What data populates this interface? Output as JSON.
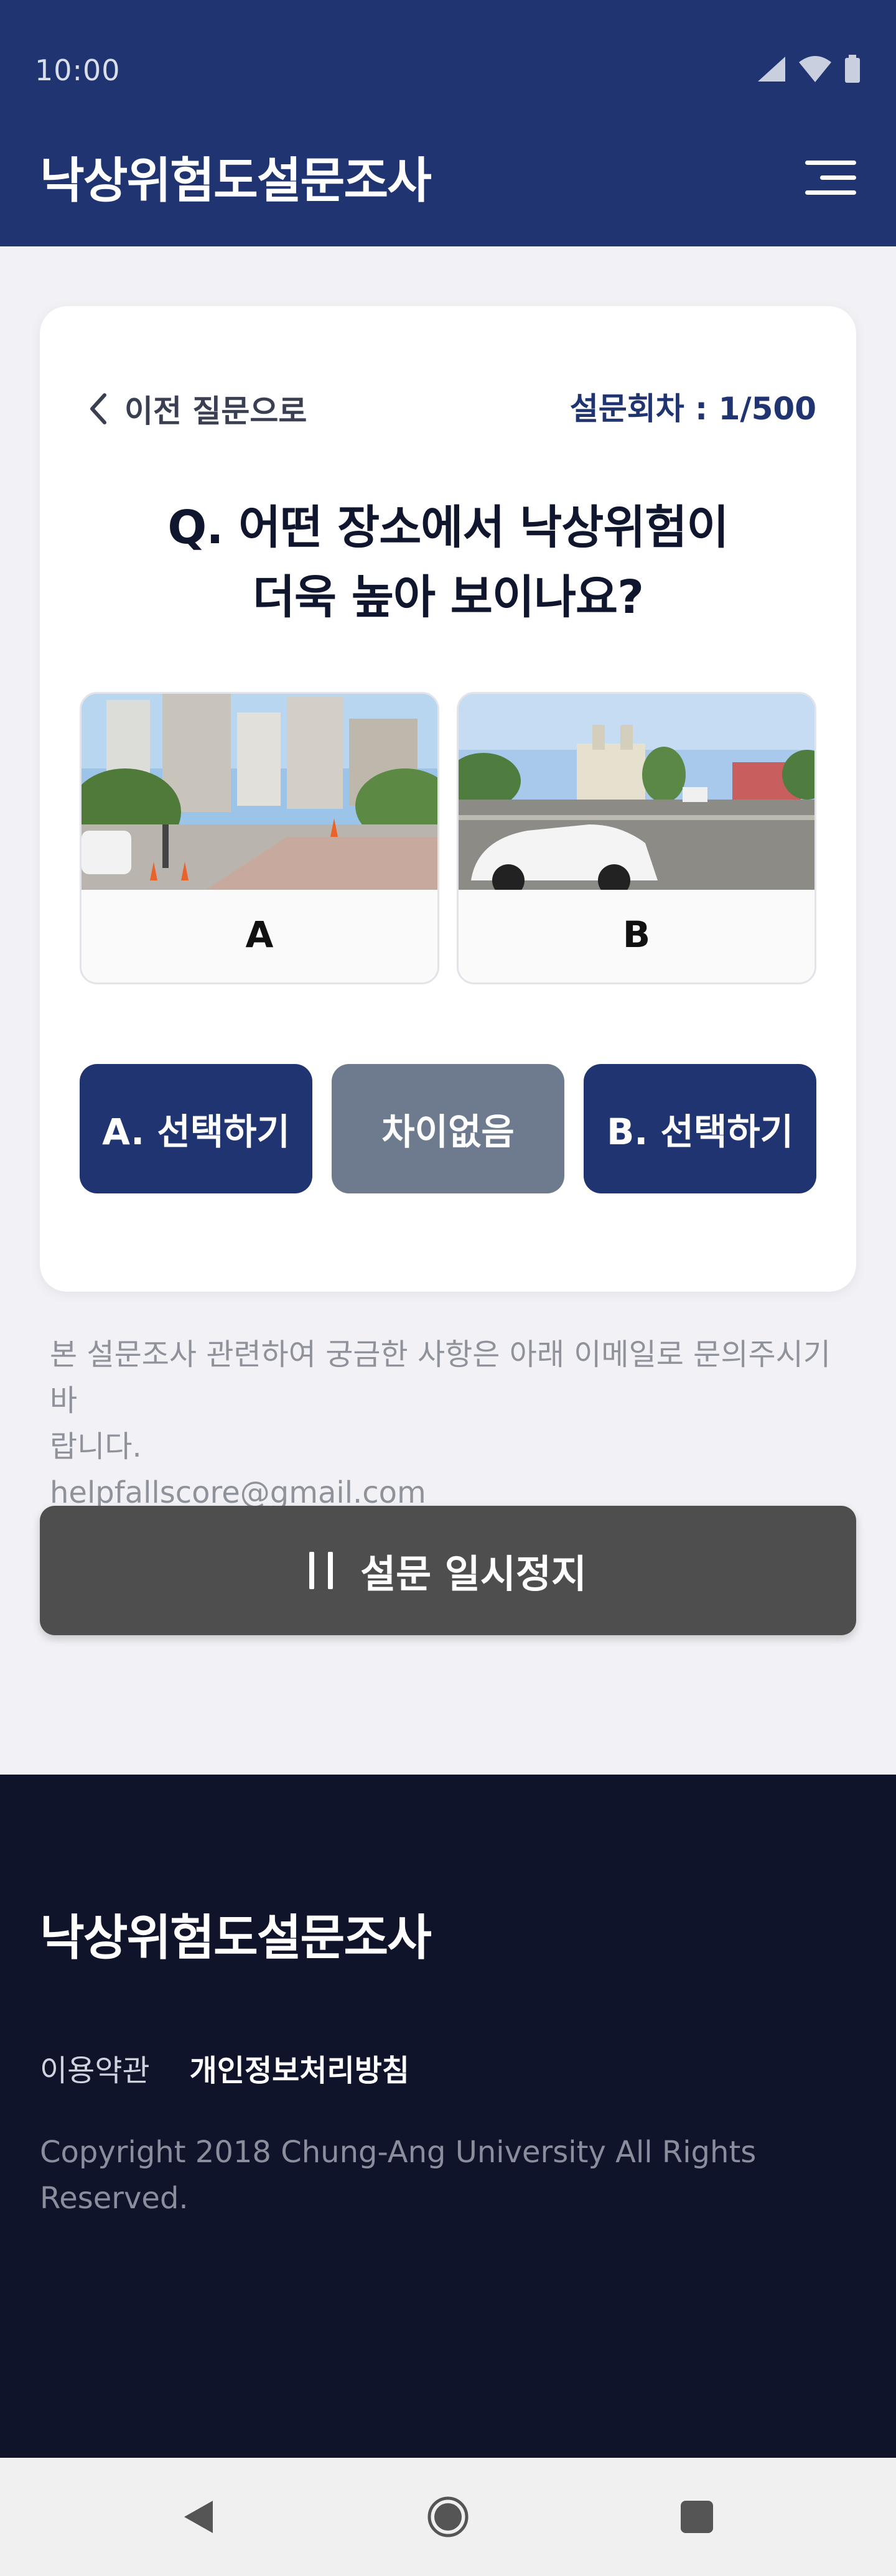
{
  "status_bar": {
    "time": "10:00"
  },
  "header": {
    "title": "낙상위험도설문조사"
  },
  "survey": {
    "prev_label": "이전 질문으로",
    "round_label": "설문회차 : 1/500",
    "question_line1": "Q. 어떤 장소에서 낙상위험이",
    "question_line2": "더욱 높아 보이나요?",
    "options": [
      {
        "label": "A"
      },
      {
        "label": "B"
      }
    ],
    "choices": {
      "a": "A. 선택하기",
      "none": "차이없음",
      "b": "B. 선택하기"
    }
  },
  "notice": {
    "line1": "본 설문조사 관련하여 궁금한 사항은 아래 이메일로 문의주시기 바",
    "line2": "랍니다.",
    "email": "helpfallscore@gmail.com"
  },
  "pause_button": {
    "label": "설문 일시정지"
  },
  "footer": {
    "title": "낙상위험도설문조사",
    "terms": "이용약관",
    "privacy": "개인정보처리방침",
    "copyright_line1": "Copyright 2018 Chung-Ang University All Rights",
    "copyright_line2": "Reserved."
  },
  "colors": {
    "brand": "#1f3470",
    "neutral_button": "#6e7a8d",
    "pause_button": "#4e4e4e",
    "footer": "#0f142b"
  }
}
